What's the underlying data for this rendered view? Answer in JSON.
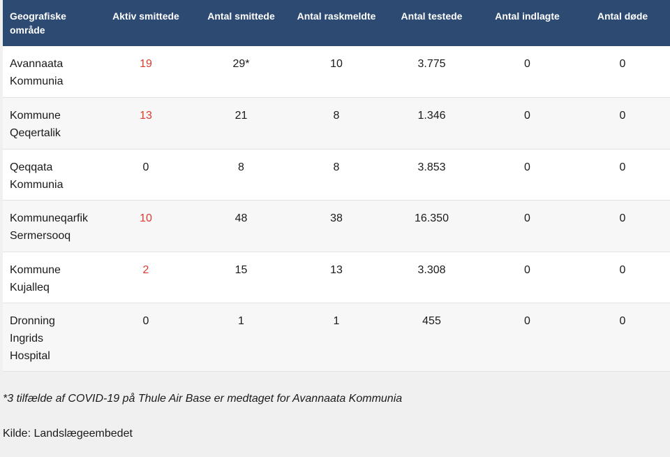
{
  "table": {
    "headers": [
      "Geografiske område",
      "Aktiv smittede",
      "Antal smittede",
      "Antal raskmeldte",
      "Antal testede",
      "Antal indlagte",
      "Antal døde"
    ],
    "rows": [
      {
        "area": "Avannaata Kommunia",
        "active": "19",
        "infected": "29*",
        "recovered": "10",
        "tested": "3.775",
        "hospitalized": "0",
        "deaths": "0"
      },
      {
        "area": "Kommune Qeqertalik",
        "active": "13",
        "infected": "21",
        "recovered": "8",
        "tested": "1.346",
        "hospitalized": "0",
        "deaths": "0"
      },
      {
        "area": "Qeqqata Kommunia",
        "active": "0",
        "infected": "8",
        "recovered": "8",
        "tested": "3.853",
        "hospitalized": "0",
        "deaths": "0"
      },
      {
        "area": "Kommuneqarfik Sermersooq",
        "active": "10",
        "infected": "48",
        "recovered": "38",
        "tested": "16.350",
        "hospitalized": "0",
        "deaths": "0"
      },
      {
        "area": "Kommune Kujalleq",
        "active": "2",
        "infected": "15",
        "recovered": "13",
        "tested": "3.308",
        "hospitalized": "0",
        "deaths": "0"
      },
      {
        "area": "Dronning Ingrids Hospital",
        "active": "0",
        "infected": "1",
        "recovered": "1",
        "tested": "455",
        "hospitalized": "0",
        "deaths": "0"
      }
    ]
  },
  "notes": {
    "footnote": "*3 tilfælde af COVID-19 på Thule Air Base er medtaget for Avannaata Kommunia",
    "source": "Kilde: Landslægeembedet"
  },
  "colors": {
    "header_bg": "#2c4a72",
    "active_highlight": "#e03a2f"
  }
}
